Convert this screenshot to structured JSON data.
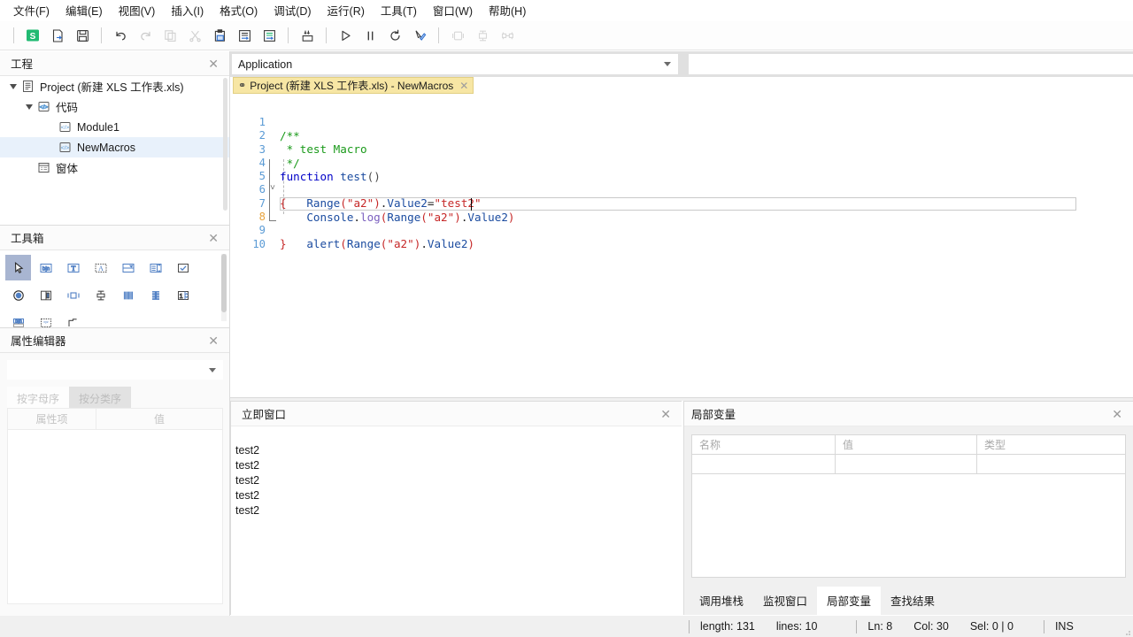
{
  "menu": {
    "items": [
      {
        "label": "文件(F)",
        "name": "menu-file"
      },
      {
        "label": "编辑(E)",
        "name": "menu-edit"
      },
      {
        "label": "视图(V)",
        "name": "menu-view"
      },
      {
        "label": "插入(I)",
        "name": "menu-insert"
      },
      {
        "label": "格式(O)",
        "name": "menu-format"
      },
      {
        "label": "调试(D)",
        "name": "menu-debug"
      },
      {
        "label": "运行(R)",
        "name": "menu-run"
      },
      {
        "label": "工具(T)",
        "name": "menu-tools"
      },
      {
        "label": "窗口(W)",
        "name": "menu-window"
      },
      {
        "label": "帮助(H)",
        "name": "menu-help"
      }
    ]
  },
  "toolbar": {
    "buttons": [
      {
        "name": "excel-logo-icon",
        "title": "S"
      },
      {
        "name": "export-icon",
        "title": ""
      },
      {
        "name": "save-icon",
        "title": ""
      },
      {
        "name": "undo-icon",
        "title": ""
      },
      {
        "name": "redo-icon",
        "title": ""
      },
      {
        "name": "copy-icon",
        "title": ""
      },
      {
        "name": "cut-icon",
        "title": ""
      },
      {
        "name": "paste-icon",
        "title": ""
      },
      {
        "name": "indent-icon",
        "title": ""
      },
      {
        "name": "outdent-icon",
        "title": ""
      },
      {
        "name": "insert-breakpoint-icon",
        "title": ""
      },
      {
        "name": "run-icon",
        "title": ""
      },
      {
        "name": "pause-icon",
        "title": ""
      },
      {
        "name": "reset-icon",
        "title": ""
      },
      {
        "name": "design-mode-icon",
        "title": ""
      },
      {
        "name": "project-explorer-icon",
        "title": ""
      },
      {
        "name": "properties-window-icon",
        "title": ""
      },
      {
        "name": "object-browser-icon",
        "title": ""
      }
    ]
  },
  "project_panel": {
    "title": "工程",
    "close_label": "✕",
    "tree": [
      {
        "label": "Project (新建 XLS 工作表.xls)",
        "indent": 0,
        "expandable": true,
        "icon": "project-icon",
        "selected": false
      },
      {
        "label": "代码",
        "indent": 1,
        "expandable": true,
        "icon": "code-folder-icon",
        "selected": false
      },
      {
        "label": "Module1",
        "indent": 2,
        "expandable": false,
        "icon": "module-icon",
        "selected": false
      },
      {
        "label": "NewMacros",
        "indent": 2,
        "expandable": false,
        "icon": "module-icon",
        "selected": true
      },
      {
        "label": "窗体",
        "indent": 1,
        "expandable": false,
        "icon": "form-icon",
        "selected": false
      }
    ]
  },
  "toolbox_panel": {
    "title": "工具箱",
    "close_label": "✕",
    "tools": [
      {
        "name": "pointer-tool-icon",
        "selected": true
      },
      {
        "name": "label-tool-icon",
        "selected": false
      },
      {
        "name": "textbox-tool-icon",
        "selected": false
      },
      {
        "name": "richtext-tool-icon",
        "selected": false
      },
      {
        "name": "combobox-tool-icon",
        "selected": false
      },
      {
        "name": "listbox-tool-icon",
        "selected": false
      },
      {
        "name": "checkbox-tool-icon",
        "selected": false
      },
      {
        "name": "optionbutton-tool-icon",
        "selected": false
      },
      {
        "name": "togglebutton-tool-icon",
        "selected": false
      },
      {
        "name": "frame-tool-icon",
        "selected": false
      },
      {
        "name": "commandbutton-tool-icon",
        "selected": false
      },
      {
        "name": "tabstrip-tool-icon",
        "selected": false
      },
      {
        "name": "multipage-tool-icon",
        "selected": false
      },
      {
        "name": "spinbutton-tool-icon",
        "selected": false
      },
      {
        "name": "scrollbar-tool-icon",
        "selected": false
      },
      {
        "name": "image-tool-icon",
        "selected": false
      },
      {
        "name": "refedit-tool-icon",
        "selected": false
      }
    ]
  },
  "property_panel": {
    "title": "属性编辑器",
    "close_label": "✕",
    "combo_value": "",
    "tabs": [
      {
        "label": "按字母序",
        "active": true
      },
      {
        "label": "按分类序",
        "active": false
      }
    ],
    "columns": [
      "属性项",
      "值"
    ],
    "rows": []
  },
  "editor": {
    "dropdown_left": "Application",
    "dropdown_right": "",
    "tab": {
      "pin_icon": "pin-icon",
      "label": "Project (新建 XLS 工作表.xls) - NewMacros",
      "close_label": "✕"
    },
    "current_line": 8,
    "lines": [
      {
        "n": 1,
        "text": "/**"
      },
      {
        "n": 2,
        "text": " * test Macro"
      },
      {
        "n": 3,
        "text": " */"
      },
      {
        "n": 4,
        "text": "function test()"
      },
      {
        "n": 5,
        "text": "{"
      },
      {
        "n": 6,
        "text": "    Range(\"a2\").Value2=\"test2\""
      },
      {
        "n": 7,
        "text": "    Console.log(Range(\"a2\").Value2)"
      },
      {
        "n": 8,
        "text": "    alert(Range(\"a2\").Value2)"
      },
      {
        "n": 9,
        "text": "}"
      },
      {
        "n": 10,
        "text": ""
      }
    ]
  },
  "immediate_window": {
    "title": "立即窗口",
    "close_label": "✕",
    "output": [
      "test2",
      "test2",
      "test2",
      "test2",
      "test2"
    ]
  },
  "locals_window": {
    "title": "局部变量",
    "close_label": "✕",
    "columns": [
      "名称",
      "值",
      "类型"
    ],
    "rows": [
      [
        "",
        "",
        ""
      ]
    ],
    "tabs": [
      {
        "label": "调用堆栈",
        "active": false
      },
      {
        "label": "监视窗口",
        "active": false
      },
      {
        "label": "局部变量",
        "active": true
      },
      {
        "label": "查找结果",
        "active": false
      }
    ]
  },
  "status_bar": {
    "length": "length: 131",
    "lines": "lines: 10",
    "ln": "Ln: 8",
    "col": "Col: 30",
    "sel": "Sel: 0 | 0",
    "mode": "INS"
  },
  "colors": {
    "tab_active": "#f7e6a4",
    "tree_selected": "#e8f1fb",
    "tool_selected": "#a8b5d1",
    "accent_blue": "#5b9bd5",
    "keyword": "#0000c8",
    "comment": "#1a9a1a",
    "string": "#c62828",
    "current_line_num": "#e8a33d",
    "logo_green": "#21ba72"
  }
}
